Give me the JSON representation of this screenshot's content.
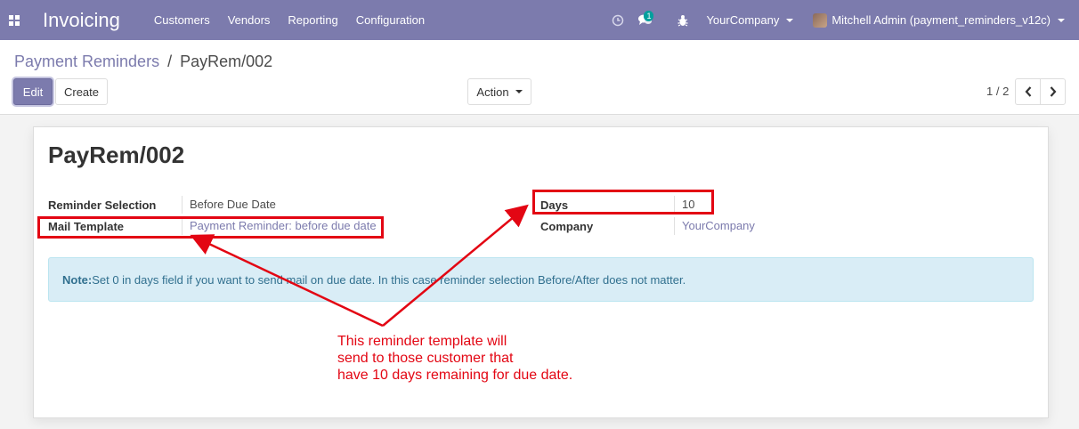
{
  "navbar": {
    "app_title": "Invoicing",
    "menu": [
      "Customers",
      "Vendors",
      "Reporting",
      "Configuration"
    ],
    "messages_badge": "1",
    "company": "YourCompany",
    "user": "Mitchell Admin (payment_reminders_v12c)",
    "color": "#7c7bad"
  },
  "control_panel": {
    "breadcrumb_parent": "Payment Reminders",
    "breadcrumb_separator": "/",
    "breadcrumb_current": "PayRem/002",
    "edit_label": "Edit",
    "create_label": "Create",
    "action_label": "Action",
    "pager": "1 / 2"
  },
  "form": {
    "title": "PayRem/002",
    "reminder_selection_label": "Reminder Selection",
    "reminder_selection_value": "Before Due Date",
    "mail_template_label": "Mail Template",
    "mail_template_value": "Payment Reminder: before due date",
    "days_label": "Days",
    "days_value": "10",
    "company_label": "Company",
    "company_value": "YourCompany",
    "note_label": "Note:",
    "note_text": "Set 0 in days field if you want to send mail on due date. In this case reminder selection Before/After does not matter."
  },
  "annotation": {
    "line1": "This reminder template will",
    "line2": "send to those customer that",
    "line3": "have 10 days remaining for due date.",
    "color": "#e30613"
  }
}
